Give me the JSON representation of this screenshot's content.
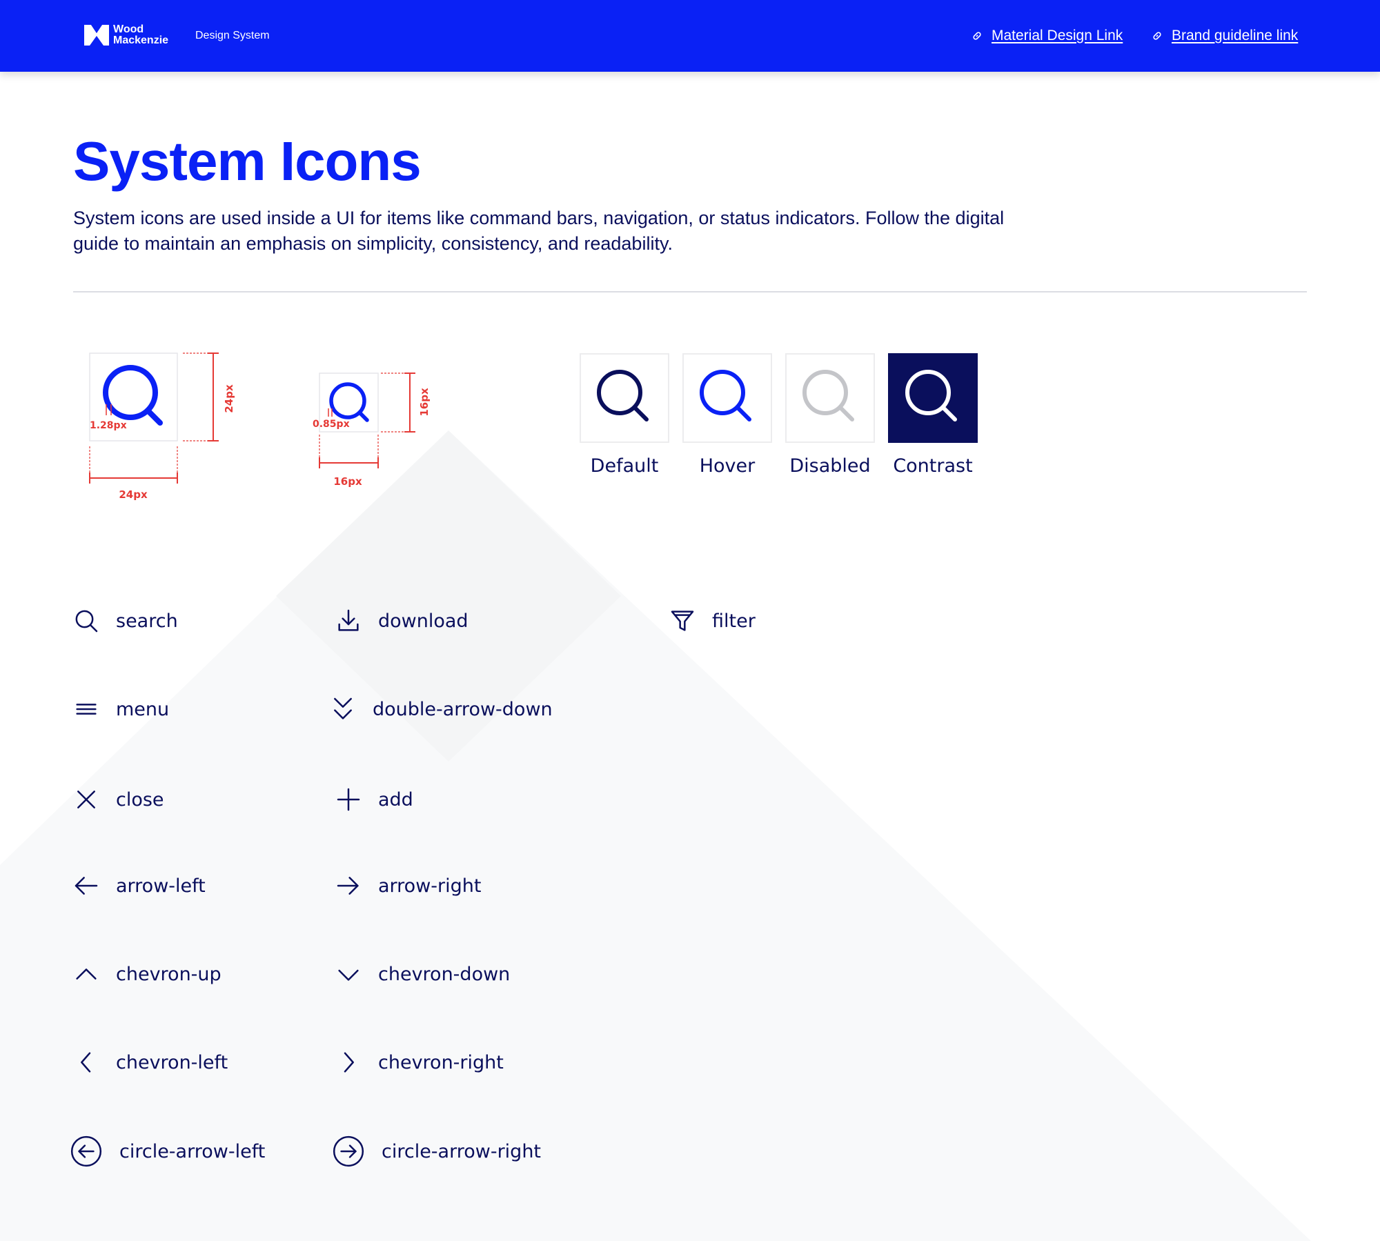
{
  "header": {
    "brand_line1": "Wood",
    "brand_line2": "Mackenzie",
    "section": "Design System",
    "links": [
      {
        "label": "Material Design Link",
        "icon": "link-icon"
      },
      {
        "label": "Brand guideline link",
        "icon": "link-icon"
      }
    ]
  },
  "page": {
    "title": "System Icons",
    "description": "System icons are used inside a UI for items like command bars, navigation, or status indicators. Follow the digital guide to maintain an emphasis on simplicity, consistency, and readability."
  },
  "specs": [
    {
      "size_label": "24px",
      "stroke_label": "1.28px"
    },
    {
      "size_label": "16px",
      "stroke_label": "0.85px"
    }
  ],
  "states": [
    {
      "label": "Default",
      "color": "#0a0f5c"
    },
    {
      "label": "Hover",
      "color": "#0a21f5"
    },
    {
      "label": "Disabled",
      "color": "#c4c5c9"
    },
    {
      "label": "Contrast",
      "color": "#ffffff",
      "background": "#0a0f5c"
    }
  ],
  "icons": [
    {
      "name": "search",
      "icon": "search-icon"
    },
    {
      "name": "download",
      "icon": "download-icon"
    },
    {
      "name": "filter",
      "icon": "filter-icon"
    },
    {
      "name": "menu",
      "icon": "menu-icon"
    },
    {
      "name": "double-arrow-down",
      "icon": "double-arrow-down-icon"
    },
    {
      "name": "close",
      "icon": "close-icon"
    },
    {
      "name": "add",
      "icon": "add-icon"
    },
    {
      "name": "arrow-left",
      "icon": "arrow-left-icon"
    },
    {
      "name": "arrow-right",
      "icon": "arrow-right-icon"
    },
    {
      "name": "chevron-up",
      "icon": "chevron-up-icon"
    },
    {
      "name": "chevron-down",
      "icon": "chevron-down-icon"
    },
    {
      "name": "chevron-left",
      "icon": "chevron-left-icon"
    },
    {
      "name": "chevron-right",
      "icon": "chevron-right-icon"
    },
    {
      "name": "circle-arrow-left",
      "icon": "circle-arrow-left-icon"
    },
    {
      "name": "circle-arrow-right",
      "icon": "circle-arrow-right-icon"
    }
  ],
  "colors": {
    "brand_blue": "#0a21f5",
    "navy": "#0a0f5c",
    "spec_red": "#e53935",
    "disabled_grey": "#c4c5c9"
  }
}
